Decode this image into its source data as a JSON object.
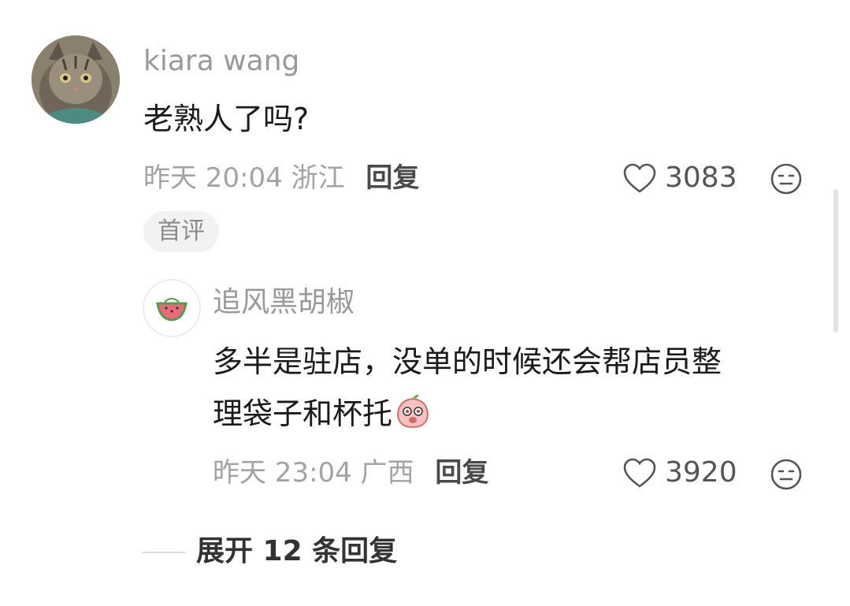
{
  "comment": {
    "username": "kiara wang",
    "text": "老熟人了吗?",
    "time": "昨天 20:04",
    "location": "浙江",
    "reply_label": "回复",
    "likes": "3083",
    "badge": "首评"
  },
  "reply": {
    "username": "追风黑胡椒",
    "text_line1": "多半是驻店，没单的时候还会帮店员整",
    "text_line2": "理袋子和杯托",
    "time": "昨天 23:04",
    "location": "广西",
    "reply_label": "回复",
    "likes": "3920"
  },
  "expand": {
    "label": "展开 12 条回复"
  },
  "icons": {
    "avatar_main": "cat-avatar",
    "avatar_reply": "watermelon-avatar",
    "like": "heart-icon",
    "dislike": "neutral-face-icon",
    "emoji": "peach-emoji"
  }
}
